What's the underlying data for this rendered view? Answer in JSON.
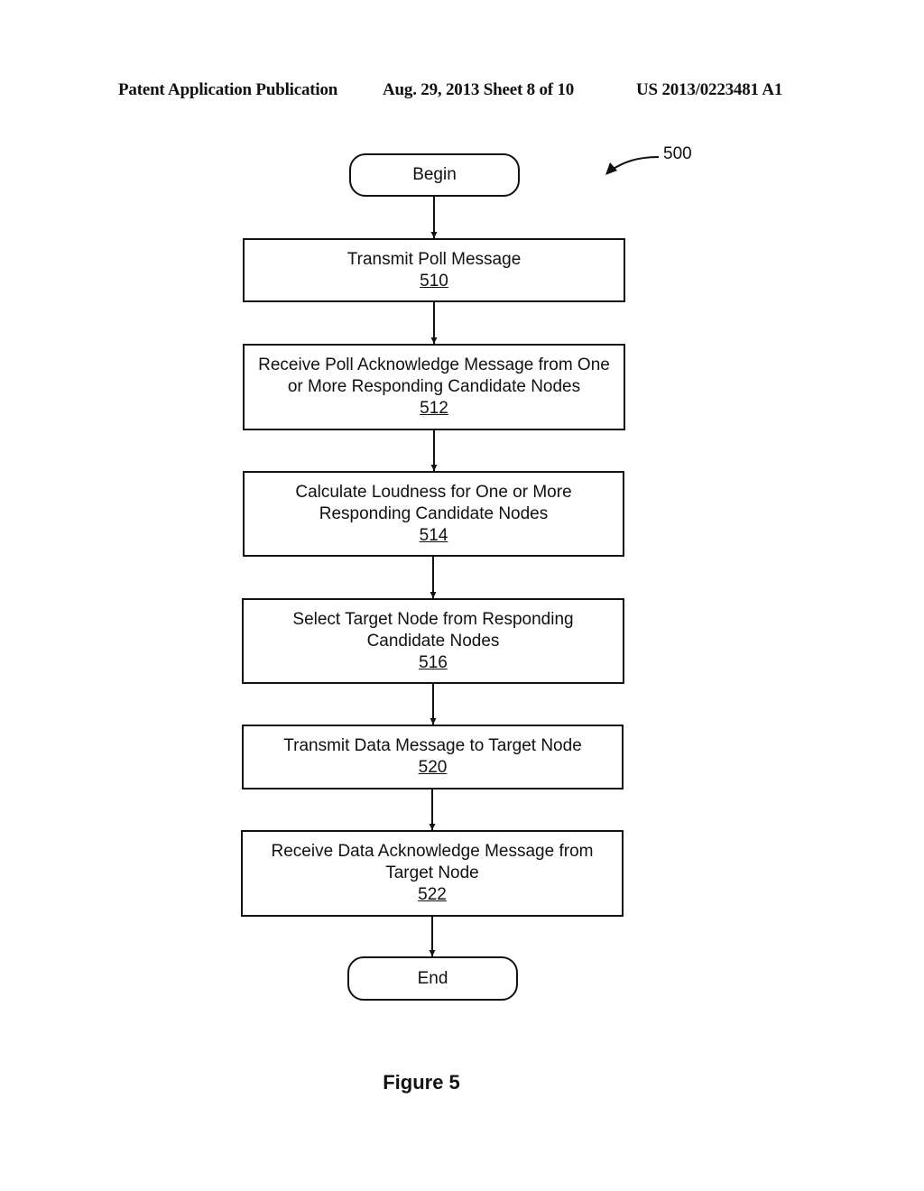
{
  "header": {
    "left": "Patent Application Publication",
    "middle": "Aug. 29, 2013  Sheet 8 of 10",
    "right": "US 2013/0223481 A1"
  },
  "figure": {
    "reference_numeral": "500",
    "caption": "Figure 5",
    "begin_label": "Begin",
    "end_label": "End",
    "steps": [
      {
        "lines": [
          "Transmit Poll Message"
        ],
        "ref": "510"
      },
      {
        "lines": [
          "Receive Poll Acknowledge Message from One",
          "or More Responding Candidate Nodes"
        ],
        "ref": "512"
      },
      {
        "lines": [
          "Calculate Loudness for One or More",
          "Responding Candidate Nodes"
        ],
        "ref": "514"
      },
      {
        "lines": [
          "Select Target Node from Responding",
          "Candidate Nodes"
        ],
        "ref": "516"
      },
      {
        "lines": [
          "Transmit Data Message to Target Node"
        ],
        "ref": "520"
      },
      {
        "lines": [
          "Receive Data Acknowledge Message from",
          "Target Node"
        ],
        "ref": "522"
      }
    ]
  }
}
